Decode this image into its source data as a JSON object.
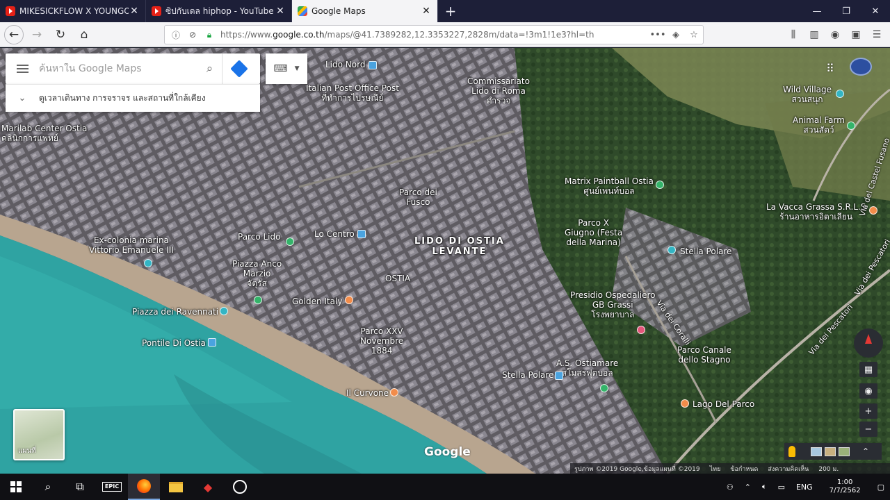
{
  "browser": {
    "tabs": [
      {
        "title": "MIKESICKFLOW X YOUNGOHM",
        "icon": "youtube-icon",
        "active": false
      },
      {
        "title": "ซิปกับเดล hiphop - YouTube",
        "icon": "youtube-icon",
        "active": false
      },
      {
        "title": "Google Maps",
        "icon": "google-maps-icon",
        "active": true
      }
    ],
    "url_prefix": "https://www.",
    "url_host": "google.co.th",
    "url_rest": "/maps/@41.7389282,12.3353227,2828m/data=!3m1!1e3?hl=th",
    "more_glyph": "•••"
  },
  "maps": {
    "search_placeholder": "ค้นหาใน Google Maps",
    "explore_label": "ดูเวลาเดินทาง การจราจร และสถานที่ใกล้เคียง",
    "minimap_label": "แผนที่",
    "logo": "Google",
    "footer": [
      "รูปภาพ ©2019 Google,ข้อมูลแผนที่ ©2019",
      "ไทย",
      "ข้อกำหนด",
      "ส่งความคิดเห็น",
      "200 ม."
    ]
  },
  "places": [
    {
      "name": "Lido Nord",
      "pin": "blue"
    },
    {
      "name": "Italian Post Office Post\nที่ทำการไปรษณีย์",
      "pin": "none"
    },
    {
      "name": "Commissariato\nLido di Roma\nตำรวจ",
      "pin": "none"
    },
    {
      "name": "Marilab Center Ostia\nคลินิกการแพทย์",
      "pin": "none"
    },
    {
      "name": "Wild Village\nสวนสนุก",
      "pin": "teal"
    },
    {
      "name": "Animal Farm\nสวนสัตว์",
      "pin": "green"
    },
    {
      "name": "Parco dei\nFusco",
      "pin": "none"
    },
    {
      "name": "Matrix Paintball Ostia\nศูนย์เพนท์บอล",
      "pin": "green"
    },
    {
      "name": "La Vacca Grassa S.R.L.S\nร้านอาหารอิตาเลียน",
      "pin": "orange"
    },
    {
      "name": "Parco Lido",
      "pin": "green"
    },
    {
      "name": "Lo Centro",
      "pin": "blue"
    },
    {
      "name": "LIDO DI OSTIA\nLEVANTE",
      "pin": "none"
    },
    {
      "name": "Parco X\nGiugno (Festa\ndella Marina)",
      "pin": "none"
    },
    {
      "name": "Stella Polare",
      "pin": "teal"
    },
    {
      "name": "Ex-colonia marina\nVittorio Emanuele III",
      "pin": "teal"
    },
    {
      "name": "Piazza Anco\nMarzio\nจัตุรัส",
      "pin": "green"
    },
    {
      "name": "OSTIA",
      "pin": "none"
    },
    {
      "name": "Golden Italy",
      "pin": "orange"
    },
    {
      "name": "Presidio Ospedaliero\nGB Grassi\nโรงพยาบาล",
      "pin": "pink"
    },
    {
      "name": "Piazza dei Ravennati",
      "pin": "teal"
    },
    {
      "name": "Parco XXV\nNovembre\n1884",
      "pin": "none"
    },
    {
      "name": "Pontile Di Ostia",
      "pin": "blue"
    },
    {
      "name": "Parco Canale\ndello Stagno",
      "pin": "none"
    },
    {
      "name": "A.S. Ostiamare\nสโมสรฟุตบอล",
      "pin": "green"
    },
    {
      "name": "Stella Polare",
      "pin": "blue"
    },
    {
      "name": "Il Curvone",
      "pin": "orange"
    },
    {
      "name": "Lago Del Parco",
      "pin": "orange"
    }
  ],
  "roads": [
    "Via del Castel Fusano",
    "Via dei Pescatori",
    "Via dei Coralli",
    "Via dei Pescatori"
  ],
  "taskbar": {
    "lang": "ENG",
    "time": "1:00",
    "date": "7/7/2562",
    "epic_label": "EPIC"
  }
}
